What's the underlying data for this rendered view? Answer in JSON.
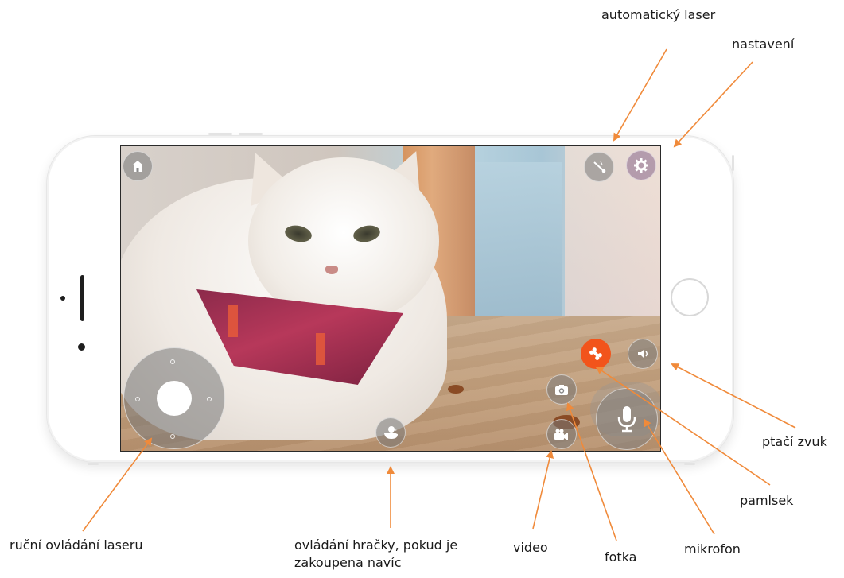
{
  "annotations": {
    "auto_laser": "automatický laser",
    "settings": "nastavení",
    "bird_sound": "ptačí zvuk",
    "treat": "pamlsek",
    "manual_laser": "ruční ovládání laseru",
    "toy_control": "ovládání hračky, pokud je zakoupena navíc",
    "video": "video",
    "photo": "fotka",
    "microphone": "mikrofon"
  },
  "colors": {
    "arrow": "#f08a3a",
    "treat_button": "#f2541b",
    "overlay_button": "#787878"
  },
  "icons": {
    "home": "home-icon",
    "auto_laser": "laser-pointer-icon",
    "settings": "gear-icon",
    "treat": "bone-icon",
    "bird_sound": "speaker-icon",
    "photo": "camera-icon",
    "video": "video-camera-icon",
    "toy": "duck-icon",
    "microphone": "microphone-icon",
    "joystick": "joystick-knob"
  }
}
